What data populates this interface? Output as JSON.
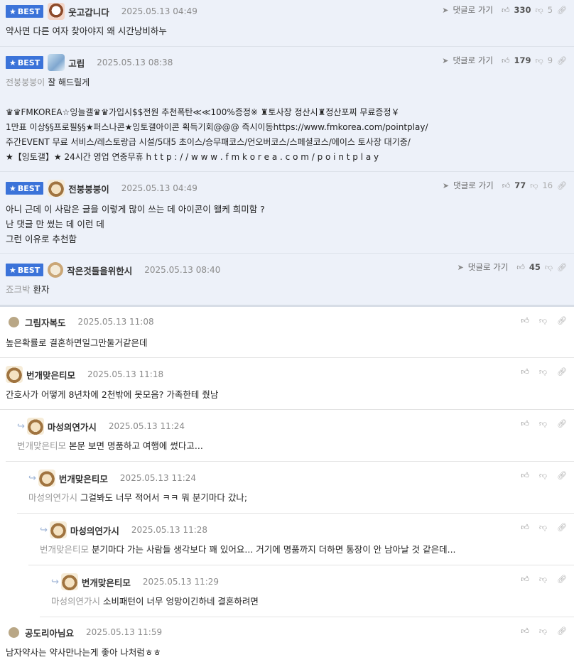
{
  "best_label": "BEST",
  "reply_link": "댓글로 가기",
  "best_comments": [
    {
      "nick": "웃고갑니다",
      "date": "2025.05.13 04:49",
      "likes": "330",
      "dislikes": "5",
      "lines": [
        "약사면 다른 여자 찾아야지 왜 시간낭비하누"
      ]
    },
    {
      "nick": "고립",
      "date": "2025.05.13 08:38",
      "likes": "179",
      "dislikes": "9",
      "mention": "전붕붕붕이",
      "first": "잘 해드릴게",
      "lines": [
        "♛♛FMKOREA☆잉늘갤♛♛가입시$$전원 추천폭탄≪≪100%증정※ ♜토사장 정산시♜정산포찌 무료증정￥",
        "1만표 이상§§프로필§§★퍼스나콘★잉토갤아이콘 획득기회@@@ 즉시이동https://www.fmkorea.com/pointplay/",
        "주간EVENT 무료 서비스/레스토랑급 시설/5대5 초이스/승무패코스/언오버코스/스페셜코스/에이스 토사장 대기중/",
        "★【잉토갤】★ 24시간 영업 연중무휴 h t t p : / / w w w . f m k o r e a . c o m / p o i n t p l a y"
      ]
    },
    {
      "nick": "전붕붕붕이",
      "date": "2025.05.13 04:49",
      "likes": "77",
      "dislikes": "16",
      "lines": [
        "아니 근데 이 사람은 글을 이렇게 많이 쓰는 데 아이콘이 왤케 희미함 ?",
        "난 댓글 만 썼는 데 이런 데",
        "그런 이유로 추천함"
      ]
    },
    {
      "nick": "작은것들을위한시",
      "date": "2025.05.13 08:40",
      "likes": "45",
      "dislikes": "",
      "mention": "죠크박",
      "first": "환자"
    }
  ],
  "comments": [
    {
      "nick": "그림자복도",
      "date": "2025.05.13 11:08",
      "text": "높은확률로 결혼하면일그만둘거같은데"
    },
    {
      "nick": "번개맞은티모",
      "date": "2025.05.13 11:18",
      "text": "간호사가 어떻게 8년차에 2천밖에 못모음? 가족한테 줬남"
    },
    {
      "nick": "마성의연가시",
      "date": "2025.05.13 11:24",
      "mention": "번개맞은티모",
      "text": "본문 보면 명품하고 여행에 썼다고..."
    },
    {
      "nick": "번개맞은티모",
      "date": "2025.05.13 11:24",
      "mention": "마성의연가시",
      "text": "그걸봐도 너무 적어서 ㅋㅋ 뭐 분기마다 갔나;"
    },
    {
      "nick": "마성의연가시",
      "date": "2025.05.13 11:28",
      "mention": "번개맞은티모",
      "text": "분기마다 가는 사람들 생각보다 꽤 있어요... 거기에 명품까지 더하면 통장이 안 남아날 것 같은데..."
    },
    {
      "nick": "번개맞은티모",
      "date": "2025.05.13 11:29",
      "mention": "마성의연가시",
      "text": "소비패턴이 너무 엉망이긴하네 결혼하려면"
    },
    {
      "nick": "공도리아님요",
      "date": "2025.05.13 11:59",
      "text": "남자약사는 약사만나는게 좋아 나처럼ㅎㅎ"
    }
  ]
}
